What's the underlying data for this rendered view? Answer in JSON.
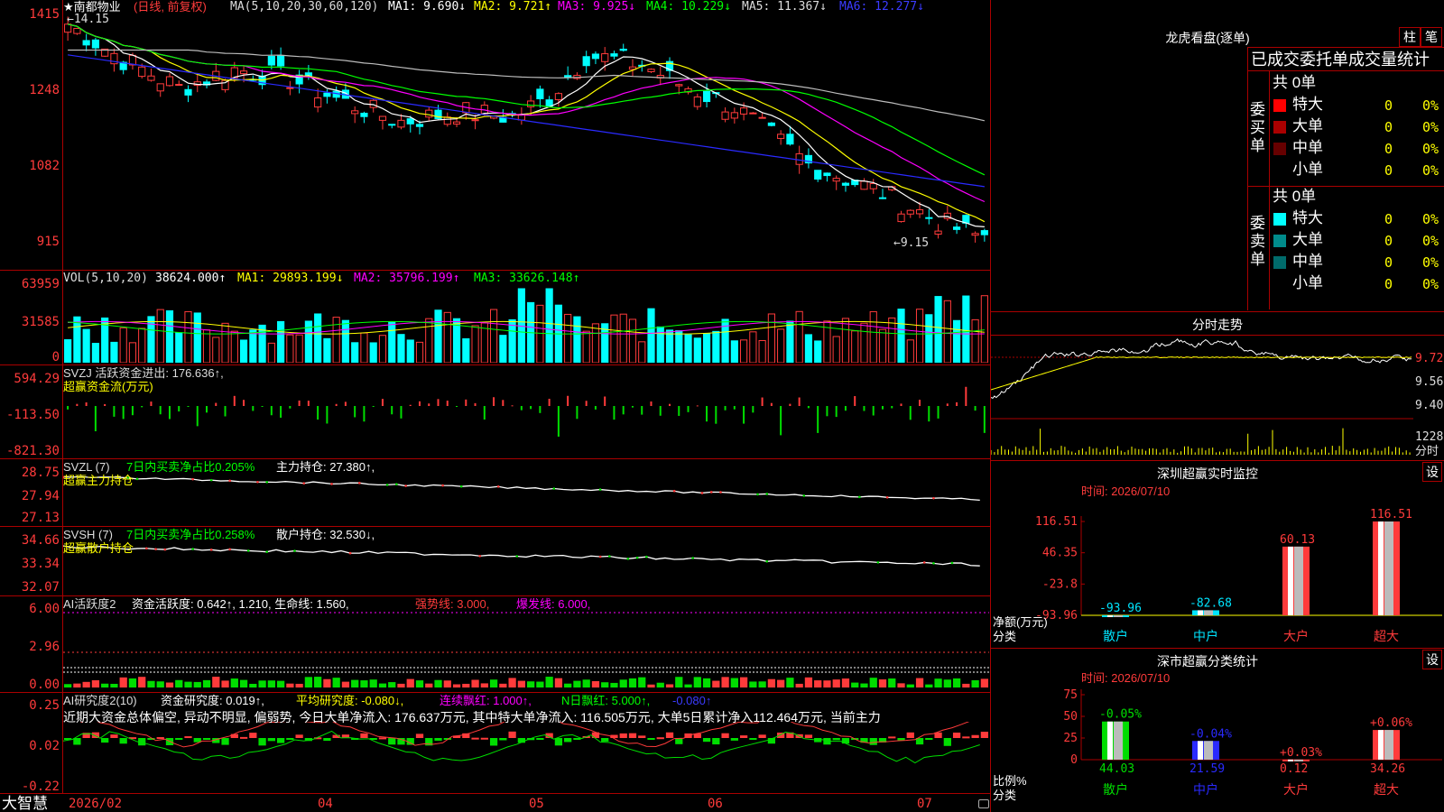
{
  "main": {
    "title": "★南都物业",
    "mode": "(日线, 前复权)",
    "ma_label": "MA(5,10,20,30,60,120)",
    "ma_values": [
      {
        "label": "MA1: 9.690↓",
        "color": "#ffffff"
      },
      {
        "label": "MA2: 9.721↑",
        "color": "#ffff00"
      },
      {
        "label": "MA3: 9.925↓",
        "color": "#ff00ff"
      },
      {
        "label": "MA4: 10.229↓",
        "color": "#00ff00"
      },
      {
        "label": "MA5: 11.367↓",
        "color": "#bbbbbb"
      },
      {
        "label": "MA6: 12.277↓",
        "color": "#2a2aff"
      }
    ],
    "high_mark": "14.15",
    "low_mark": "9.15",
    "y_ticks": [
      "1415",
      "1248",
      "1082",
      "915"
    ]
  },
  "vol": {
    "label": "VOL(5,10,20)",
    "value": "38624.000↑",
    "ma1": "MA1: 29893.199↓",
    "ma2": "MA2: 35796.199↑",
    "ma3": "MA3: 33626.148↑",
    "y_ticks": [
      "63959",
      "31585",
      "0"
    ]
  },
  "svzj": {
    "label": "SVZJ  活跃资金进出: 176.636↑,",
    "sub": "超赢资金流(万元)",
    "y_ticks": [
      "594.29",
      "-113.50",
      "-821.30"
    ]
  },
  "svzl": {
    "label": "SVZL (7)",
    "l2": "7日内买卖净占比0.205%",
    "l3": "主力持仓: 27.380↑,",
    "sub": "超赢主力持仓",
    "y_ticks": [
      "28.75",
      "27.94",
      "27.13"
    ]
  },
  "svsh": {
    "label": "SVSH (7)",
    "l2": "7日内买卖净占比0.258%",
    "l3": "散户持仓: 32.530↓,",
    "sub": "超赢散户持仓",
    "y_ticks": [
      "34.66",
      "33.34",
      "32.07"
    ]
  },
  "ai1": {
    "label": "AI活跃度2",
    "a": "资金活跃度: 0.642↑, 1.210, 生命线: 1.560,",
    "b": "强势线: 3.000,",
    "c": "爆发线: 6.000,",
    "y_ticks": [
      "6.00",
      "2.96",
      "0.00"
    ]
  },
  "ai2": {
    "label": "AI研究度2(10)",
    "a": "资金研究度: 0.019↑,",
    "b": "平均研究度: -0.080↓,",
    "c": "连续飘红: 1.000↑,",
    "d": "N日飘红: 5.000↑,",
    "e": "-0.080↑",
    "comment": "近期大资金总体偏空, 异动不明显, 偏弱势, 今日大单净流入: 176.637万元, 其中特大单净流入: 116.505万元, 大单5日累计净入112.464万元, 当前主力",
    "y_ticks": [
      "0.25",
      "0.02",
      "-0.22"
    ]
  },
  "bottom": {
    "brand": "大智慧",
    "dates": [
      "2026/02",
      "04",
      "05",
      "06",
      "07"
    ]
  },
  "dragon": {
    "title": "龙虎看盘(逐单)",
    "btn1": "柱",
    "btn2": "笔",
    "subtitle": "已成交委托单成交量统计",
    "buy_label": "委买单",
    "sell_label": "委卖单",
    "buy_total": "共 0单",
    "sell_total": "共 0单",
    "buy_rows": [
      {
        "name": "特大",
        "count": "0",
        "pct": "0%",
        "color": "#ff0000"
      },
      {
        "name": "大单",
        "count": "0",
        "pct": "0%",
        "color": "#aa0000"
      },
      {
        "name": "中单",
        "count": "0",
        "pct": "0%",
        "color": "#660000"
      },
      {
        "name": "小单",
        "count": "0",
        "pct": "0%",
        "color": "#000000"
      }
    ],
    "sell_rows": [
      {
        "name": "特大",
        "count": "0",
        "pct": "0%",
        "color": "#00ffff"
      },
      {
        "name": "大单",
        "count": "0",
        "pct": "0%",
        "color": "#008b8b"
      },
      {
        "name": "中单",
        "count": "0",
        "pct": "0%",
        "color": "#006b6b"
      },
      {
        "name": "小单",
        "count": "0",
        "pct": "0%",
        "color": "#000000"
      }
    ]
  },
  "intraday": {
    "title": "分时走势",
    "y_ticks": [
      "9.72",
      "9.56",
      "9.40"
    ],
    "vol_tick": "1228",
    "vol_label": "分时"
  },
  "monitor": {
    "title": "深圳超赢实时监控",
    "btn": "设",
    "time": "时间: 2026/07/10",
    "y_ticks": [
      "116.51",
      "46.35",
      "-23.8",
      "-93.96"
    ],
    "ylabel": "净额(万元)",
    "xlabel": "分类",
    "bars": [
      {
        "cat": "散户",
        "value": -93.96,
        "label": "-93.96",
        "color": "#00e5ff"
      },
      {
        "cat": "中户",
        "value": -82.68,
        "label": "-82.68",
        "color": "#00e5ff"
      },
      {
        "cat": "大户",
        "value": 60.13,
        "label": "60.13",
        "color": "#ff3b3b"
      },
      {
        "cat": "超大",
        "value": 116.51,
        "label": "116.51",
        "color": "#ff3b3b"
      }
    ]
  },
  "classify": {
    "title": "深市超赢分类统计",
    "btn": "设",
    "time": "时间: 2026/07/10",
    "y_ticks": [
      "75",
      "50",
      "25",
      "0"
    ],
    "ylabel": "比例%",
    "xlabel": "分类",
    "bars": [
      {
        "cat": "散户",
        "value": 44.03,
        "label": "44.03",
        "delta": "-0.05%",
        "color": "#00dd00"
      },
      {
        "cat": "中户",
        "value": 21.59,
        "label": "21.59",
        "delta": "-0.04%",
        "color": "#2a2aff"
      },
      {
        "cat": "大户",
        "value": 0.12,
        "label": "0.12",
        "delta": "+0.03%",
        "color": "#ff3b3b"
      },
      {
        "cat": "超大",
        "value": 34.26,
        "label": "34.26",
        "delta": "+0.06%",
        "color": "#ff3b3b"
      }
    ]
  }
}
